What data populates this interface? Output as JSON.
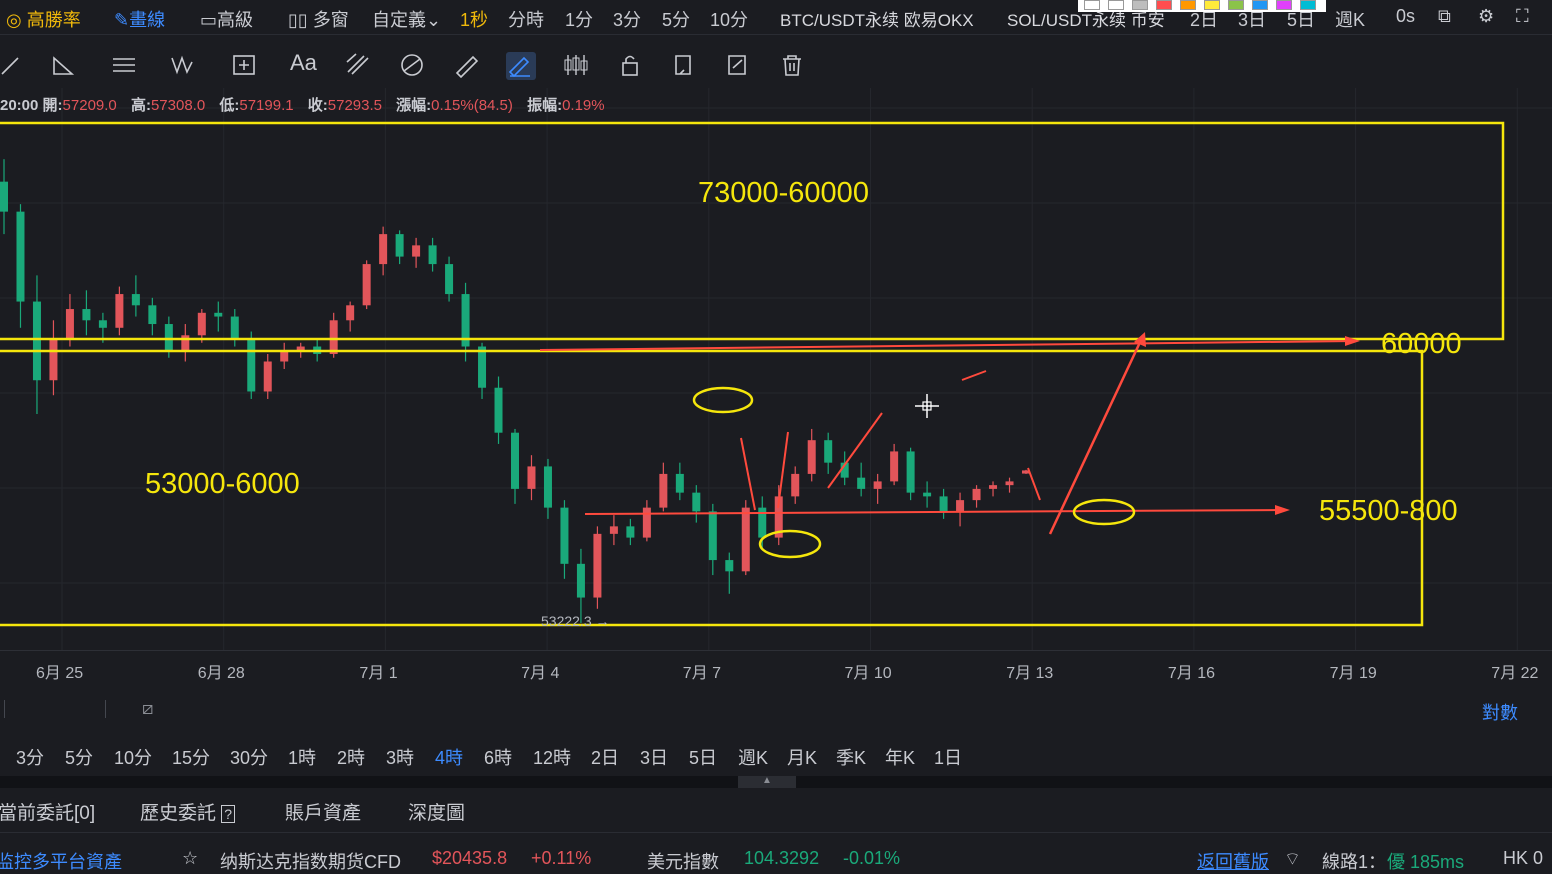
{
  "topbar": {
    "high_win": "高勝率",
    "draw": "畫線",
    "advanced": "高級",
    "multi_window": "多窗",
    "custom": "自定義",
    "interval_1s": "1秒",
    "time_share": "分時",
    "m1": "1分",
    "m3": "3分",
    "m5": "5分",
    "m10": "10分",
    "ticker_1": "BTC/USDT永续 欧易OKX",
    "ticker_2": "SOL/USDT永续 币安",
    "d2": "2日",
    "d3": "3日",
    "d5": "5日",
    "week": "週K",
    "seconds": "0s"
  },
  "swatch_colors": [
    "#ffffff",
    "#ffffff",
    "#bdbdbd",
    "#ff4d4f",
    "#ff9800",
    "#ffeb3b",
    "#8bc34a",
    "#2196f3",
    "#e040fb",
    "#00bcd4"
  ],
  "toolbar": {
    "text_tool": "Aa",
    "icons": [
      "trend-line-icon",
      "angle-icon",
      "parallel-lines-icon",
      "wave-icon",
      "measure-icon",
      "text-icon",
      "fib-icon",
      "gann-icon",
      "ruler-icon",
      "brush-icon",
      "candles-icon",
      "lock-icon",
      "copy-icon",
      "edit-icon",
      "trash-icon"
    ]
  },
  "ohlc": {
    "time": "20:00",
    "open_label": "開:",
    "open": "57209.0",
    "high_label": "高:",
    "high": "57308.0",
    "low_label": "低:",
    "low": "57199.1",
    "close_label": "收:",
    "close": "57293.5",
    "change_label": "漲幅:",
    "change": "0.15%(84.5)",
    "amp_label": "振幅:",
    "amp": "0.19%"
  },
  "annotations": {
    "upper_zone": "73000-60000",
    "lower_zone": "53000-6000",
    "level_60000": "60000",
    "target": "55500-800",
    "low_marker": "53222.3 →"
  },
  "chart_data": {
    "type": "candlestick",
    "x_ticks": [
      "6月 25",
      "6月 28",
      "7月 1",
      "7月 4",
      "7月 7",
      "7月 10",
      "7月 13",
      "7月 16",
      "7月 19",
      "7月 22"
    ],
    "series_colors": {
      "up": "#e2555a",
      "down": "#1aa97a"
    },
    "series": [
      {
        "o": 65000,
        "h": 65600,
        "l": 63600,
        "c": 64200
      },
      {
        "o": 64200,
        "h": 64400,
        "l": 61100,
        "c": 61800
      },
      {
        "o": 61800,
        "h": 62500,
        "l": 58800,
        "c": 59700
      },
      {
        "o": 59700,
        "h": 61300,
        "l": 59300,
        "c": 60800
      },
      {
        "o": 60800,
        "h": 62000,
        "l": 60600,
        "c": 61600
      },
      {
        "o": 61600,
        "h": 62100,
        "l": 60900,
        "c": 61300
      },
      {
        "o": 61300,
        "h": 61500,
        "l": 60700,
        "c": 61100
      },
      {
        "o": 61100,
        "h": 62200,
        "l": 60900,
        "c": 62000
      },
      {
        "o": 62000,
        "h": 62500,
        "l": 61400,
        "c": 61700
      },
      {
        "o": 61700,
        "h": 61900,
        "l": 60900,
        "c": 61200
      },
      {
        "o": 61200,
        "h": 61400,
        "l": 60300,
        "c": 60500
      },
      {
        "o": 60500,
        "h": 61200,
        "l": 60200,
        "c": 60900
      },
      {
        "o": 60900,
        "h": 61600,
        "l": 60700,
        "c": 61500
      },
      {
        "o": 61500,
        "h": 61800,
        "l": 61000,
        "c": 61400
      },
      {
        "o": 61400,
        "h": 61600,
        "l": 60600,
        "c": 60800
      },
      {
        "o": 60800,
        "h": 61000,
        "l": 59200,
        "c": 59400
      },
      {
        "o": 59400,
        "h": 60400,
        "l": 59200,
        "c": 60200
      },
      {
        "o": 60200,
        "h": 60700,
        "l": 60000,
        "c": 60500
      },
      {
        "o": 60500,
        "h": 60700,
        "l": 60300,
        "c": 60600
      },
      {
        "o": 60600,
        "h": 60800,
        "l": 60200,
        "c": 60400
      },
      {
        "o": 60400,
        "h": 61500,
        "l": 60300,
        "c": 61300
      },
      {
        "o": 61300,
        "h": 61800,
        "l": 61000,
        "c": 61700
      },
      {
        "o": 61700,
        "h": 62900,
        "l": 61600,
        "c": 62800
      },
      {
        "o": 62800,
        "h": 63800,
        "l": 62500,
        "c": 63600
      },
      {
        "o": 63600,
        "h": 63700,
        "l": 62800,
        "c": 63000
      },
      {
        "o": 63000,
        "h": 63500,
        "l": 62700,
        "c": 63300
      },
      {
        "o": 63300,
        "h": 63500,
        "l": 62600,
        "c": 62800
      },
      {
        "o": 62800,
        "h": 63000,
        "l": 61800,
        "c": 62000
      },
      {
        "o": 62000,
        "h": 62300,
        "l": 60200,
        "c": 60600
      },
      {
        "o": 60600,
        "h": 60700,
        "l": 59200,
        "c": 59500
      },
      {
        "o": 59500,
        "h": 59800,
        "l": 58000,
        "c": 58300
      },
      {
        "o": 58300,
        "h": 58400,
        "l": 56400,
        "c": 56800
      },
      {
        "o": 56800,
        "h": 57700,
        "l": 56500,
        "c": 57400
      },
      {
        "o": 57400,
        "h": 57600,
        "l": 56000,
        "c": 56300
      },
      {
        "o": 56300,
        "h": 56500,
        "l": 54400,
        "c": 54800
      },
      {
        "o": 54800,
        "h": 55200,
        "l": 53222,
        "c": 53900
      },
      {
        "o": 53900,
        "h": 55800,
        "l": 53600,
        "c": 55600
      },
      {
        "o": 55600,
        "h": 56100,
        "l": 55300,
        "c": 55800
      },
      {
        "o": 55800,
        "h": 56000,
        "l": 55300,
        "c": 55500
      },
      {
        "o": 55500,
        "h": 56500,
        "l": 55400,
        "c": 56300
      },
      {
        "o": 56300,
        "h": 57500,
        "l": 56200,
        "c": 57200
      },
      {
        "o": 57200,
        "h": 57500,
        "l": 56500,
        "c": 56700
      },
      {
        "o": 56700,
        "h": 56900,
        "l": 55900,
        "c": 56200
      },
      {
        "o": 56200,
        "h": 56400,
        "l": 54500,
        "c": 54900
      },
      {
        "o": 54900,
        "h": 55100,
        "l": 54000,
        "c": 54600
      },
      {
        "o": 54600,
        "h": 56500,
        "l": 54500,
        "c": 56300
      },
      {
        "o": 56300,
        "h": 56600,
        "l": 55200,
        "c": 55500
      },
      {
        "o": 55500,
        "h": 56900,
        "l": 55300,
        "c": 56600
      },
      {
        "o": 56600,
        "h": 57400,
        "l": 56400,
        "c": 57200
      },
      {
        "o": 57200,
        "h": 58400,
        "l": 57000,
        "c": 58100
      },
      {
        "o": 58100,
        "h": 58300,
        "l": 57200,
        "c": 57500
      },
      {
        "o": 57500,
        "h": 57800,
        "l": 56900,
        "c": 57100
      },
      {
        "o": 57100,
        "h": 57500,
        "l": 56600,
        "c": 56800
      },
      {
        "o": 56800,
        "h": 57200,
        "l": 56400,
        "c": 57000
      },
      {
        "o": 57000,
        "h": 58000,
        "l": 56900,
        "c": 57800
      },
      {
        "o": 57800,
        "h": 57900,
        "l": 56500,
        "c": 56700
      },
      {
        "o": 56700,
        "h": 57000,
        "l": 56300,
        "c": 56600
      },
      {
        "o": 56600,
        "h": 56800,
        "l": 56000,
        "c": 56200
      },
      {
        "o": 56200,
        "h": 56700,
        "l": 55800,
        "c": 56500
      },
      {
        "o": 56500,
        "h": 56900,
        "l": 56300,
        "c": 56800
      },
      {
        "o": 56800,
        "h": 57000,
        "l": 56600,
        "c": 56900
      },
      {
        "o": 56900,
        "h": 57100,
        "l": 56700,
        "c": 57000
      },
      {
        "o": 57209,
        "h": 57308,
        "l": 57199,
        "c": 57293
      }
    ],
    "ylim": [
      52500,
      67500
    ]
  },
  "bottom": {
    "log_label": "對數",
    "intervals": [
      "3分",
      "5分",
      "10分",
      "15分",
      "30分",
      "1時",
      "2時",
      "3時",
      "4時",
      "6時",
      "12時",
      "2日",
      "3日",
      "5日",
      "週K",
      "月K",
      "季K",
      "年K",
      "1日"
    ],
    "active_interval": "4時",
    "tabs": [
      "當前委託[0]",
      "歷史委託",
      "賬戶資產",
      "深度圖"
    ]
  },
  "status": {
    "left": "监控多平台資產",
    "nasdaq_label": "纳斯达克指数期货CFD",
    "nasdaq_value": "$20435.8",
    "nasdaq_change": "+0.11%",
    "dxy_label": "美元指數",
    "dxy_value": "104.3292",
    "dxy_change": "-0.01%",
    "back_old": "返回舊版",
    "line_label": "線路1：",
    "line_quality": "優 185ms",
    "region": "HK 0"
  }
}
